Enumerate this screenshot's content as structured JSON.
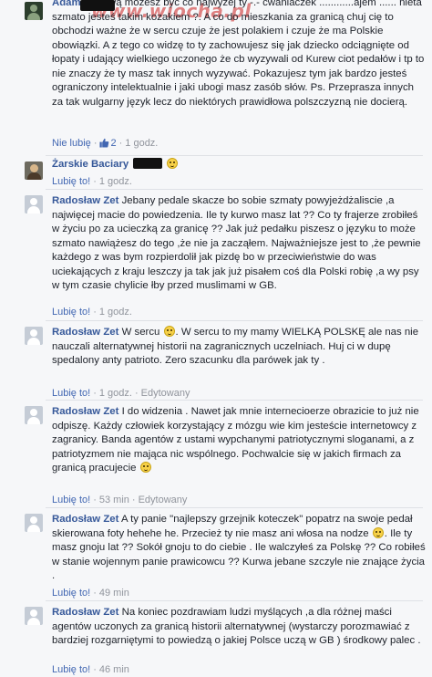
{
  "watermark": "www.wiocha.pl",
  "comments": [
    {
      "author": "Adam",
      "text": "A Kurwą możesz być co najwyżej ty -.- cwaniaczek ............ajem ...... nieta szmato jesteś takim kozakiem ?. A co do mieszkania za granicą chuj cię to obchodzi ważne że w sercu czuje że jest polakiem i czuje że ma Polskie obowiązki. A z tego co widzę to ty zachowujesz się jak dziecko odciągnięte od łopaty i udający wielkiego uczonego że cb wyzywali od Kurew ciot pedałów i tp to nie znaczy że ty masz tak innych wyzywać. Pokazujesz tym jak bardzo jesteś ograniczony intelektualnie i jaki ubogi masz zasób słów. Ps. Przeprasza innych za tak wulgarny język lecz do niektórych prawidłowa polszczyzną nie docierą.",
      "action": "Nie lubię",
      "like_count": "2",
      "time": "1 godz.",
      "edited": ""
    },
    {
      "author": "Żarskie Baciary",
      "text": "",
      "action": "Lubię to!",
      "like_count": "",
      "time": "1 godz.",
      "edited": ""
    },
    {
      "author": "Radosław Zet",
      "text": "Jebany pedale skacze bo sobie szmaty powyjeżdżaliscie ,a najwięcej macie do powiedzenia. Ile ty kurwo masz lat ?? Co ty frajerze zrobiłeś w życiu po za ucieczką za granicę ?? Jak już pedałku piszesz o języku to może szmato nawiążesz do tego ,że nie ja zacząłem. Najważniejsze jest to ,że pewnie każdego z was bym rozpierdolił jak pizdę bo w przeciwieństwie do was uciekających z kraju leszczy ja tak jak już pisałem coś dla Polski robię ,a wy psy w tym czasie chylicie łby przed muslimami w GB.",
      "action": "Lubię to!",
      "like_count": "",
      "time": "1 godz.",
      "edited": ""
    },
    {
      "author": "Radosław Zet",
      "text_before": "W sercu",
      "text": ". W sercu to my mamy WIELKĄ POLSKĘ ale nas nie nauczali alternatywnej historii na zagranicznych uczelniach. Huj ci w dupę spedalony anty patrioto. Zero szacunku dla parówek jak ty .",
      "action": "Lubię to!",
      "like_count": "",
      "time": "1 godz.",
      "edited": "Edytowany"
    },
    {
      "author": "Radosław Zet",
      "text": "I do widzenia . Nawet jak mnie internecioerze obrazicie to już nie odpiszę. Każdy człowiek korzystający z mózgu wie kim jesteście internetowcy z zagranicy. Banda agentów z ustami wypchanymi patriotycznymi sloganami, a z patriotyzmem nie mająca nic wspólnego. Pochwalcie się w jakich firmach za granicą pracujecie",
      "action": "Lubię to!",
      "like_count": "",
      "time": "53 min",
      "edited": "Edytowany"
    },
    {
      "author": "Radosław Zet",
      "text": "A ty panie \"najlepszy grzejnik koteczek\" popatrz na swoje pedał skierowana foty hehehe he. Przecież ty nie masz ani włosa na nodze",
      "text_after": ". Ile ty masz gnoju lat ?? Sokół gnoju to do ciebie . Ile walczyłeś za Polskę ?? Co robiłeś w stanie wojennym panie prawicowcu ?? Kurwa jebane szczyle nie znające życia .",
      "action": "Lubię to!",
      "like_count": "",
      "time": "49 min",
      "edited": ""
    },
    {
      "author": "Radosław Zet",
      "text": "Na koniec pozdrawiam ludzi myślących ,a dla różnej maści agentów uczonych za granicą historii alternatywnej (wystarczy porozmawiać z bardziej rozgarniętymi to powiedzą o jakiej Polsce uczą w GB ) środkowy palec .",
      "action": "Lubię to!",
      "like_count": "",
      "time": "46 min",
      "edited": ""
    }
  ],
  "colors": {
    "background": "#f6f7f9",
    "author": "#365899",
    "action": "#4267b2",
    "meta": "#90949c"
  }
}
